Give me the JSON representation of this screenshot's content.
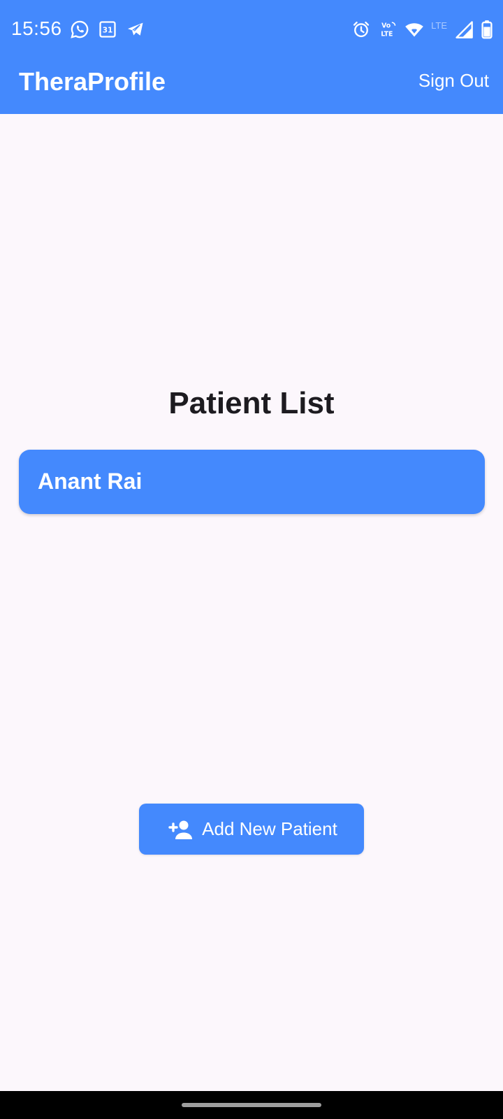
{
  "status_bar": {
    "time": "15:56",
    "left_icons": [
      "whatsapp-icon",
      "calendar-icon",
      "telegram-icon"
    ],
    "right_icons": [
      "alarm-icon",
      "volte-icon",
      "wifi-icon",
      "signal-icon",
      "battery-icon"
    ],
    "lte_label": "LTE"
  },
  "app_bar": {
    "title": "TheraProfile",
    "sign_out_label": "Sign Out"
  },
  "main": {
    "heading": "Patient List",
    "patients": [
      {
        "name": "Anant Rai"
      }
    ],
    "add_button_label": "Add New Patient"
  },
  "colors": {
    "primary": "#4489fd",
    "background": "#fcf7fc",
    "heading_text": "#1d1b20",
    "on_primary": "#ffffff"
  }
}
